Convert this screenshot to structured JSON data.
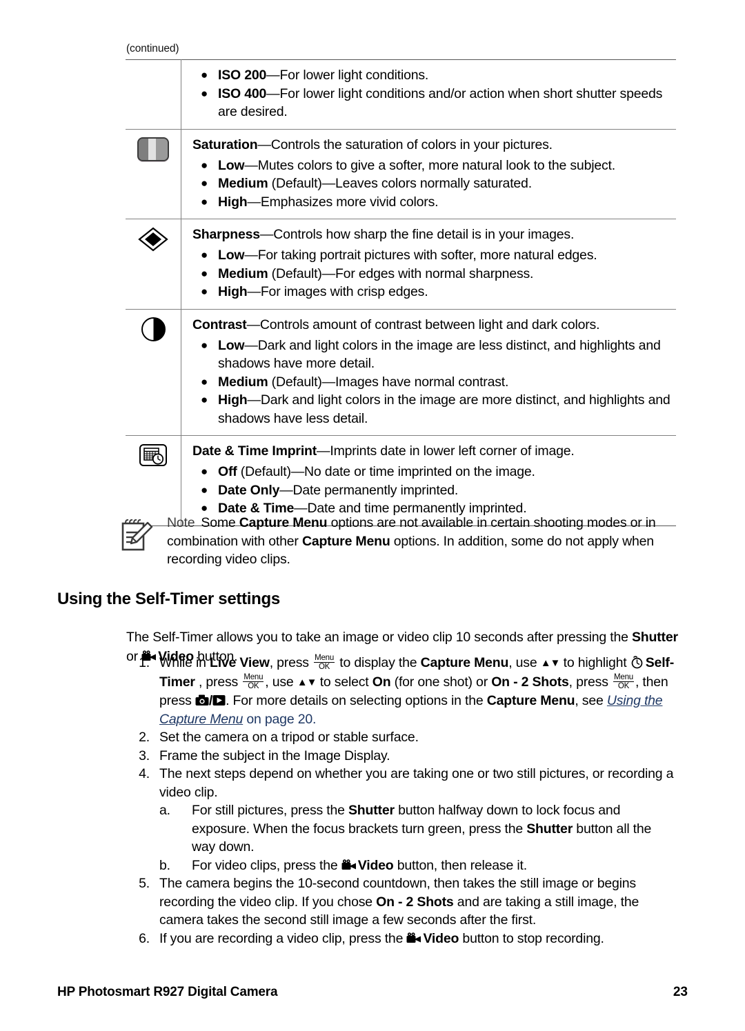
{
  "document": {
    "continued_label": "(continued)",
    "footer_left": "HP Photosmart R927 Digital Camera",
    "footer_page_number": "23",
    "link_color": "#1f3864"
  },
  "options_table": {
    "rows": [
      {
        "icon": "none",
        "heading_bold": "",
        "heading_rest": "",
        "bullets": [
          {
            "bold": "ISO 200",
            "rest": "—For lower light conditions."
          },
          {
            "bold": "ISO 400",
            "rest": "—For lower light conditions and/or action when short shutter speeds are desired."
          }
        ]
      },
      {
        "icon": "saturation-icon",
        "heading_bold": "Saturation",
        "heading_rest": "—Controls the saturation of colors in your pictures.",
        "bullets": [
          {
            "bold": "Low",
            "rest": "—Mutes colors to give a softer, more natural look to the subject."
          },
          {
            "bold": "Medium",
            "rest": " (Default)—Leaves colors normally saturated."
          },
          {
            "bold": "High",
            "rest": "—Emphasizes more vivid colors."
          }
        ]
      },
      {
        "icon": "sharpness-icon",
        "heading_bold": "Sharpness",
        "heading_rest": "—Controls how sharp the fine detail is in your images.",
        "bullets": [
          {
            "bold": "Low",
            "rest": "—For taking portrait pictures with softer, more natural edges."
          },
          {
            "bold": "Medium",
            "rest": " (Default)—For edges with normal sharpness."
          },
          {
            "bold": "High",
            "rest": "—For images with crisp edges."
          }
        ]
      },
      {
        "icon": "contrast-icon",
        "heading_bold": "Contrast",
        "heading_rest": "—Controls amount of contrast between light and dark colors.",
        "bullets": [
          {
            "bold": "Low",
            "rest": "—Dark and light colors in the image are less distinct, and highlights and shadows have more detail."
          },
          {
            "bold": "Medium",
            "rest": " (Default)—Images have normal contrast."
          },
          {
            "bold": "High",
            "rest": "—Dark and light colors in the image are more distinct, and highlights and shadows have less detail."
          }
        ]
      },
      {
        "icon": "date-time-imprint-icon",
        "heading_bold": "Date & Time Imprint",
        "heading_rest": "—Imprints date in lower left corner of image.",
        "bullets": [
          {
            "bold": "Off",
            "rest": " (Default)—No date or time imprinted on the image."
          },
          {
            "bold": "Date Only",
            "rest": "—Date permanently imprinted."
          },
          {
            "bold": "Date & Time",
            "rest": "—Date and time permanently imprinted."
          }
        ]
      }
    ]
  },
  "note": {
    "label": "Note",
    "text_1": "Some ",
    "bold_1": "Capture Menu",
    "text_2": " options are not available in certain shooting modes or in combination with other ",
    "bold_2": "Capture Menu",
    "text_3": " options. In addition, some do not apply when recording video clips."
  },
  "section": {
    "heading": "Using the Self-Timer settings",
    "intro_1": "The Self-Timer allows you to take an image or video clip 10 seconds after pressing the ",
    "intro_bold_shutter": "Shutter",
    "intro_2": " or ",
    "intro_bold_video": "Video",
    "intro_3": " button."
  },
  "steps": [
    {
      "num": "1.",
      "parts": {
        "p1": "While in ",
        "b_live_view": "Live View",
        "p2": ", press ",
        "glyph_menu": "Menu",
        "glyph_ok": "OK",
        "p3": " to display the ",
        "b_capture_menu_1": "Capture Menu",
        "p4": ", use ",
        "p5": " to highlight ",
        "b_self_timer": "Self-Timer",
        "p6": " , press ",
        "p7": ", use ",
        "p8": " to select ",
        "b_on": "On",
        "p9": " (for one shot) or ",
        "b_on_2_shots": "On - 2 Shots",
        "p10": ", press ",
        "p11": ", then press ",
        "p12": ". For more details on selecting options in the ",
        "b_capture_menu_2": "Capture Menu",
        "p13": ", see ",
        "link": "Using the Capture Menu",
        "p14": " on page 20.",
        "slash": "/"
      }
    },
    {
      "num": "2.",
      "text": "Set the camera on a tripod or stable surface."
    },
    {
      "num": "3.",
      "text": "Frame the subject in the Image Display."
    },
    {
      "num": "4.",
      "text": "The next steps depend on whether you are taking one or two still pictures, or recording a video clip."
    },
    {
      "num": "5.",
      "parts": {
        "p1": "The camera begins the 10-second countdown, then takes the still image or begins recording the video clip. If you chose ",
        "b_on_2_shots": "On - 2 Shots",
        "p2": " and are taking a still image, the camera takes the second still image a few seconds after the first."
      }
    },
    {
      "num": "6.",
      "parts": {
        "p1": "If you are recording a video clip, press the ",
        "b_video": "Video",
        "p2": " button to stop recording."
      }
    }
  ],
  "substeps": [
    {
      "num": "a.",
      "parts": {
        "p1": "For still pictures, press the ",
        "b_shutter_1": "Shutter",
        "p2": " button halfway down to lock focus and exposure. When the focus brackets turn green, press the ",
        "b_shutter_2": "Shutter",
        "p3": " button all the way down."
      }
    },
    {
      "num": "b.",
      "parts": {
        "p1": "For video clips, press the ",
        "b_video": "Video",
        "p2": " button, then release it."
      }
    }
  ]
}
